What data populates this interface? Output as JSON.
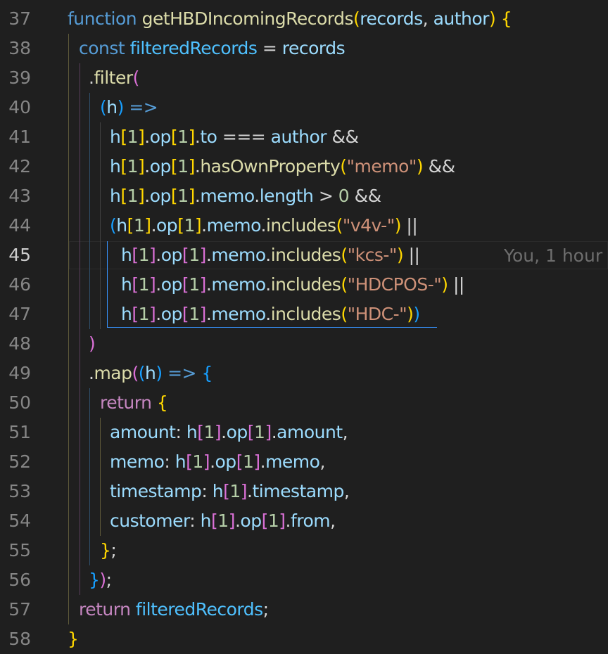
{
  "editor": {
    "language": "javascript",
    "active_line": 45,
    "blame_text": "You, 1 hour",
    "theme_colors": {
      "background": "#1f1f1f",
      "keyword": "#569cd6",
      "control": "#c586c0",
      "function": "#dcdcaa",
      "variable": "#9cdcfe",
      "string": "#ce9178",
      "number": "#b5cea8",
      "bracket_gold": "#ffd700",
      "bracket_orchid": "#da70d6",
      "bracket_blue": "#179fff",
      "line_number": "#858585"
    },
    "lines": [
      {
        "n": "37",
        "tokens": [
          [
            "function",
            "kw"
          ],
          [
            " ",
            "op"
          ],
          [
            "getHBDIncomingRecords",
            "fn"
          ],
          [
            "(",
            "b1"
          ],
          [
            "records",
            "var"
          ],
          [
            ", ",
            "op"
          ],
          [
            "author",
            "var"
          ],
          [
            ")",
            "b1"
          ],
          [
            " ",
            "op"
          ],
          [
            "{",
            "b1"
          ]
        ]
      },
      {
        "n": "38",
        "tokens": [
          [
            "const",
            "kw"
          ],
          [
            " ",
            "op"
          ],
          [
            "filteredRecords",
            "const"
          ],
          [
            " = ",
            "op"
          ],
          [
            "records",
            "var"
          ]
        ]
      },
      {
        "n": "39",
        "tokens": [
          [
            ".",
            "op"
          ],
          [
            "filter",
            "fn"
          ],
          [
            "(",
            "b2"
          ]
        ]
      },
      {
        "n": "40",
        "tokens": [
          [
            "(",
            "b3"
          ],
          [
            "h",
            "var"
          ],
          [
            ")",
            "b3"
          ],
          [
            " ",
            "op"
          ],
          [
            "=>",
            "kw"
          ]
        ]
      },
      {
        "n": "41",
        "tokens": [
          [
            "h",
            "var"
          ],
          [
            "[",
            "b1"
          ],
          [
            "1",
            "num"
          ],
          [
            "]",
            "b1"
          ],
          [
            ".",
            "op"
          ],
          [
            "op",
            "var"
          ],
          [
            "[",
            "b1"
          ],
          [
            "1",
            "num"
          ],
          [
            "]",
            "b1"
          ],
          [
            ".",
            "op"
          ],
          [
            "to",
            "var"
          ],
          [
            " === ",
            "op"
          ],
          [
            "author",
            "var"
          ],
          [
            " &&",
            "op"
          ]
        ]
      },
      {
        "n": "42",
        "tokens": [
          [
            "h",
            "var"
          ],
          [
            "[",
            "b1"
          ],
          [
            "1",
            "num"
          ],
          [
            "]",
            "b1"
          ],
          [
            ".",
            "op"
          ],
          [
            "op",
            "var"
          ],
          [
            "[",
            "b1"
          ],
          [
            "1",
            "num"
          ],
          [
            "]",
            "b1"
          ],
          [
            ".",
            "op"
          ],
          [
            "hasOwnProperty",
            "fn"
          ],
          [
            "(",
            "b1"
          ],
          [
            "\"memo\"",
            "str"
          ],
          [
            ")",
            "b1"
          ],
          [
            " &&",
            "op"
          ]
        ]
      },
      {
        "n": "43",
        "tokens": [
          [
            "h",
            "var"
          ],
          [
            "[",
            "b1"
          ],
          [
            "1",
            "num"
          ],
          [
            "]",
            "b1"
          ],
          [
            ".",
            "op"
          ],
          [
            "op",
            "var"
          ],
          [
            "[",
            "b1"
          ],
          [
            "1",
            "num"
          ],
          [
            "]",
            "b1"
          ],
          [
            ".",
            "op"
          ],
          [
            "memo",
            "var"
          ],
          [
            ".",
            "op"
          ],
          [
            "length",
            "var"
          ],
          [
            " > ",
            "op"
          ],
          [
            "0",
            "num"
          ],
          [
            " &&",
            "op"
          ]
        ]
      },
      {
        "n": "44",
        "tokens": [
          [
            "(",
            "b3"
          ],
          [
            "h",
            "var"
          ],
          [
            "[",
            "b1"
          ],
          [
            "1",
            "num"
          ],
          [
            "]",
            "b1"
          ],
          [
            ".",
            "op"
          ],
          [
            "op",
            "var"
          ],
          [
            "[",
            "b1"
          ],
          [
            "1",
            "num"
          ],
          [
            "]",
            "b1"
          ],
          [
            ".",
            "op"
          ],
          [
            "memo",
            "var"
          ],
          [
            ".",
            "op"
          ],
          [
            "includes",
            "fn"
          ],
          [
            "(",
            "b1"
          ],
          [
            "\"v4v-\"",
            "str"
          ],
          [
            ")",
            "b1"
          ],
          [
            " ||",
            "op"
          ]
        ]
      },
      {
        "n": "45",
        "tokens": [
          [
            "h",
            "var"
          ],
          [
            "[",
            "b2"
          ],
          [
            "1",
            "num"
          ],
          [
            "]",
            "b2"
          ],
          [
            ".",
            "op"
          ],
          [
            "op",
            "var"
          ],
          [
            "[",
            "b2"
          ],
          [
            "1",
            "num"
          ],
          [
            "]",
            "b2"
          ],
          [
            ".",
            "op"
          ],
          [
            "memo",
            "var"
          ],
          [
            ".",
            "op"
          ],
          [
            "includes",
            "fn"
          ],
          [
            "(",
            "b1"
          ],
          [
            "\"kcs-\"",
            "str"
          ],
          [
            ")",
            "b1"
          ],
          [
            " ||",
            "op"
          ]
        ]
      },
      {
        "n": "46",
        "tokens": [
          [
            "h",
            "var"
          ],
          [
            "[",
            "b2"
          ],
          [
            "1",
            "num"
          ],
          [
            "]",
            "b2"
          ],
          [
            ".",
            "op"
          ],
          [
            "op",
            "var"
          ],
          [
            "[",
            "b2"
          ],
          [
            "1",
            "num"
          ],
          [
            "]",
            "b2"
          ],
          [
            ".",
            "op"
          ],
          [
            "memo",
            "var"
          ],
          [
            ".",
            "op"
          ],
          [
            "includes",
            "fn"
          ],
          [
            "(",
            "b1"
          ],
          [
            "\"HDCPOS-\"",
            "str"
          ],
          [
            ")",
            "b1"
          ],
          [
            " ||",
            "op"
          ]
        ]
      },
      {
        "n": "47",
        "tokens": [
          [
            "h",
            "var"
          ],
          [
            "[",
            "b2"
          ],
          [
            "1",
            "num"
          ],
          [
            "]",
            "b2"
          ],
          [
            ".",
            "op"
          ],
          [
            "op",
            "var"
          ],
          [
            "[",
            "b2"
          ],
          [
            "1",
            "num"
          ],
          [
            "]",
            "b2"
          ],
          [
            ".",
            "op"
          ],
          [
            "memo",
            "var"
          ],
          [
            ".",
            "op"
          ],
          [
            "includes",
            "fn"
          ],
          [
            "(",
            "b1"
          ],
          [
            "\"HDC-\"",
            "str"
          ],
          [
            ")",
            "b1"
          ],
          [
            ")",
            "b3"
          ]
        ]
      },
      {
        "n": "48",
        "tokens": [
          [
            ")",
            "b2"
          ]
        ]
      },
      {
        "n": "49",
        "tokens": [
          [
            ".",
            "op"
          ],
          [
            "map",
            "fn"
          ],
          [
            "(",
            "b2"
          ],
          [
            "(",
            "b3"
          ],
          [
            "h",
            "var"
          ],
          [
            ")",
            "b3"
          ],
          [
            " ",
            "op"
          ],
          [
            "=>",
            "kw"
          ],
          [
            " ",
            "op"
          ],
          [
            "{",
            "b3"
          ]
        ]
      },
      {
        "n": "50",
        "tokens": [
          [
            "return",
            "ctl"
          ],
          [
            " ",
            "op"
          ],
          [
            "{",
            "b1"
          ]
        ]
      },
      {
        "n": "51",
        "tokens": [
          [
            "amount",
            "var"
          ],
          [
            ": ",
            "op"
          ],
          [
            "h",
            "var"
          ],
          [
            "[",
            "b2"
          ],
          [
            "1",
            "num"
          ],
          [
            "]",
            "b2"
          ],
          [
            ".",
            "op"
          ],
          [
            "op",
            "var"
          ],
          [
            "[",
            "b2"
          ],
          [
            "1",
            "num"
          ],
          [
            "]",
            "b2"
          ],
          [
            ".",
            "op"
          ],
          [
            "amount",
            "var"
          ],
          [
            ",",
            "op"
          ]
        ]
      },
      {
        "n": "52",
        "tokens": [
          [
            "memo",
            "var"
          ],
          [
            ": ",
            "op"
          ],
          [
            "h",
            "var"
          ],
          [
            "[",
            "b2"
          ],
          [
            "1",
            "num"
          ],
          [
            "]",
            "b2"
          ],
          [
            ".",
            "op"
          ],
          [
            "op",
            "var"
          ],
          [
            "[",
            "b2"
          ],
          [
            "1",
            "num"
          ],
          [
            "]",
            "b2"
          ],
          [
            ".",
            "op"
          ],
          [
            "memo",
            "var"
          ],
          [
            ",",
            "op"
          ]
        ]
      },
      {
        "n": "53",
        "tokens": [
          [
            "timestamp",
            "var"
          ],
          [
            ": ",
            "op"
          ],
          [
            "h",
            "var"
          ],
          [
            "[",
            "b2"
          ],
          [
            "1",
            "num"
          ],
          [
            "]",
            "b2"
          ],
          [
            ".",
            "op"
          ],
          [
            "timestamp",
            "var"
          ],
          [
            ",",
            "op"
          ]
        ]
      },
      {
        "n": "54",
        "tokens": [
          [
            "customer",
            "var"
          ],
          [
            ": ",
            "op"
          ],
          [
            "h",
            "var"
          ],
          [
            "[",
            "b2"
          ],
          [
            "1",
            "num"
          ],
          [
            "]",
            "b2"
          ],
          [
            ".",
            "op"
          ],
          [
            "op",
            "var"
          ],
          [
            "[",
            "b2"
          ],
          [
            "1",
            "num"
          ],
          [
            "]",
            "b2"
          ],
          [
            ".",
            "op"
          ],
          [
            "from",
            "var"
          ],
          [
            ",",
            "op"
          ]
        ]
      },
      {
        "n": "55",
        "tokens": [
          [
            "}",
            "b1"
          ],
          [
            ";",
            "op"
          ]
        ]
      },
      {
        "n": "56",
        "tokens": [
          [
            "}",
            "b3"
          ],
          [
            ")",
            "b2"
          ],
          [
            ";",
            "op"
          ]
        ]
      },
      {
        "n": "57",
        "tokens": [
          [
            "return",
            "ctl"
          ],
          [
            " ",
            "op"
          ],
          [
            "filteredRecords",
            "const"
          ],
          [
            ";",
            "op"
          ]
        ]
      },
      {
        "n": "58",
        "tokens": [
          [
            "}",
            "b1"
          ]
        ]
      }
    ]
  }
}
